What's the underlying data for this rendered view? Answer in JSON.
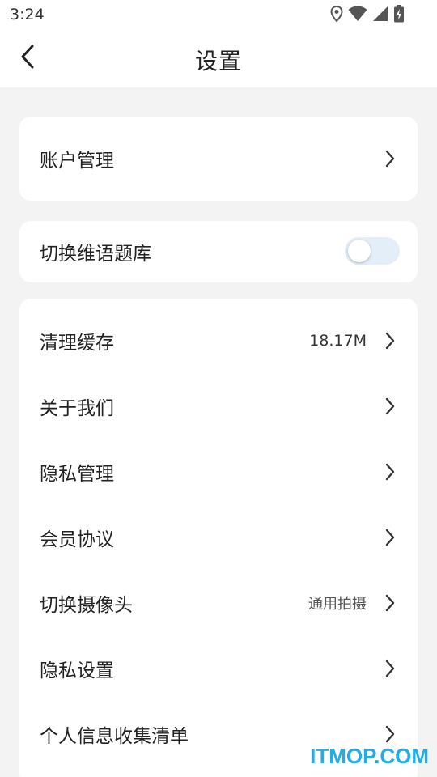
{
  "status_bar": {
    "time": "3:24",
    "icons": [
      "location-icon",
      "wifi-icon",
      "signal-icon",
      "battery-charging-icon"
    ]
  },
  "header": {
    "back_icon": "chevron-left-icon",
    "title": "设置"
  },
  "account_card": {
    "label": "账户管理"
  },
  "switch_card": {
    "label": "切换维语题库",
    "toggle_on": false
  },
  "settings_list": [
    {
      "label": "清理缓存",
      "value": "18.17M"
    },
    {
      "label": "关于我们",
      "value": ""
    },
    {
      "label": "隐私管理",
      "value": ""
    },
    {
      "label": "会员协议",
      "value": ""
    },
    {
      "label": "切换摄像头",
      "value": "通用拍摄"
    },
    {
      "label": "隐私设置",
      "value": ""
    },
    {
      "label": "个人信息收集清单",
      "value": ""
    }
  ],
  "watermark": "ITMOP.COM",
  "colors": {
    "background": "#f3f3f3",
    "card": "#ffffff",
    "toggle_track": "#e4eef9",
    "watermark": "#1faee8"
  }
}
